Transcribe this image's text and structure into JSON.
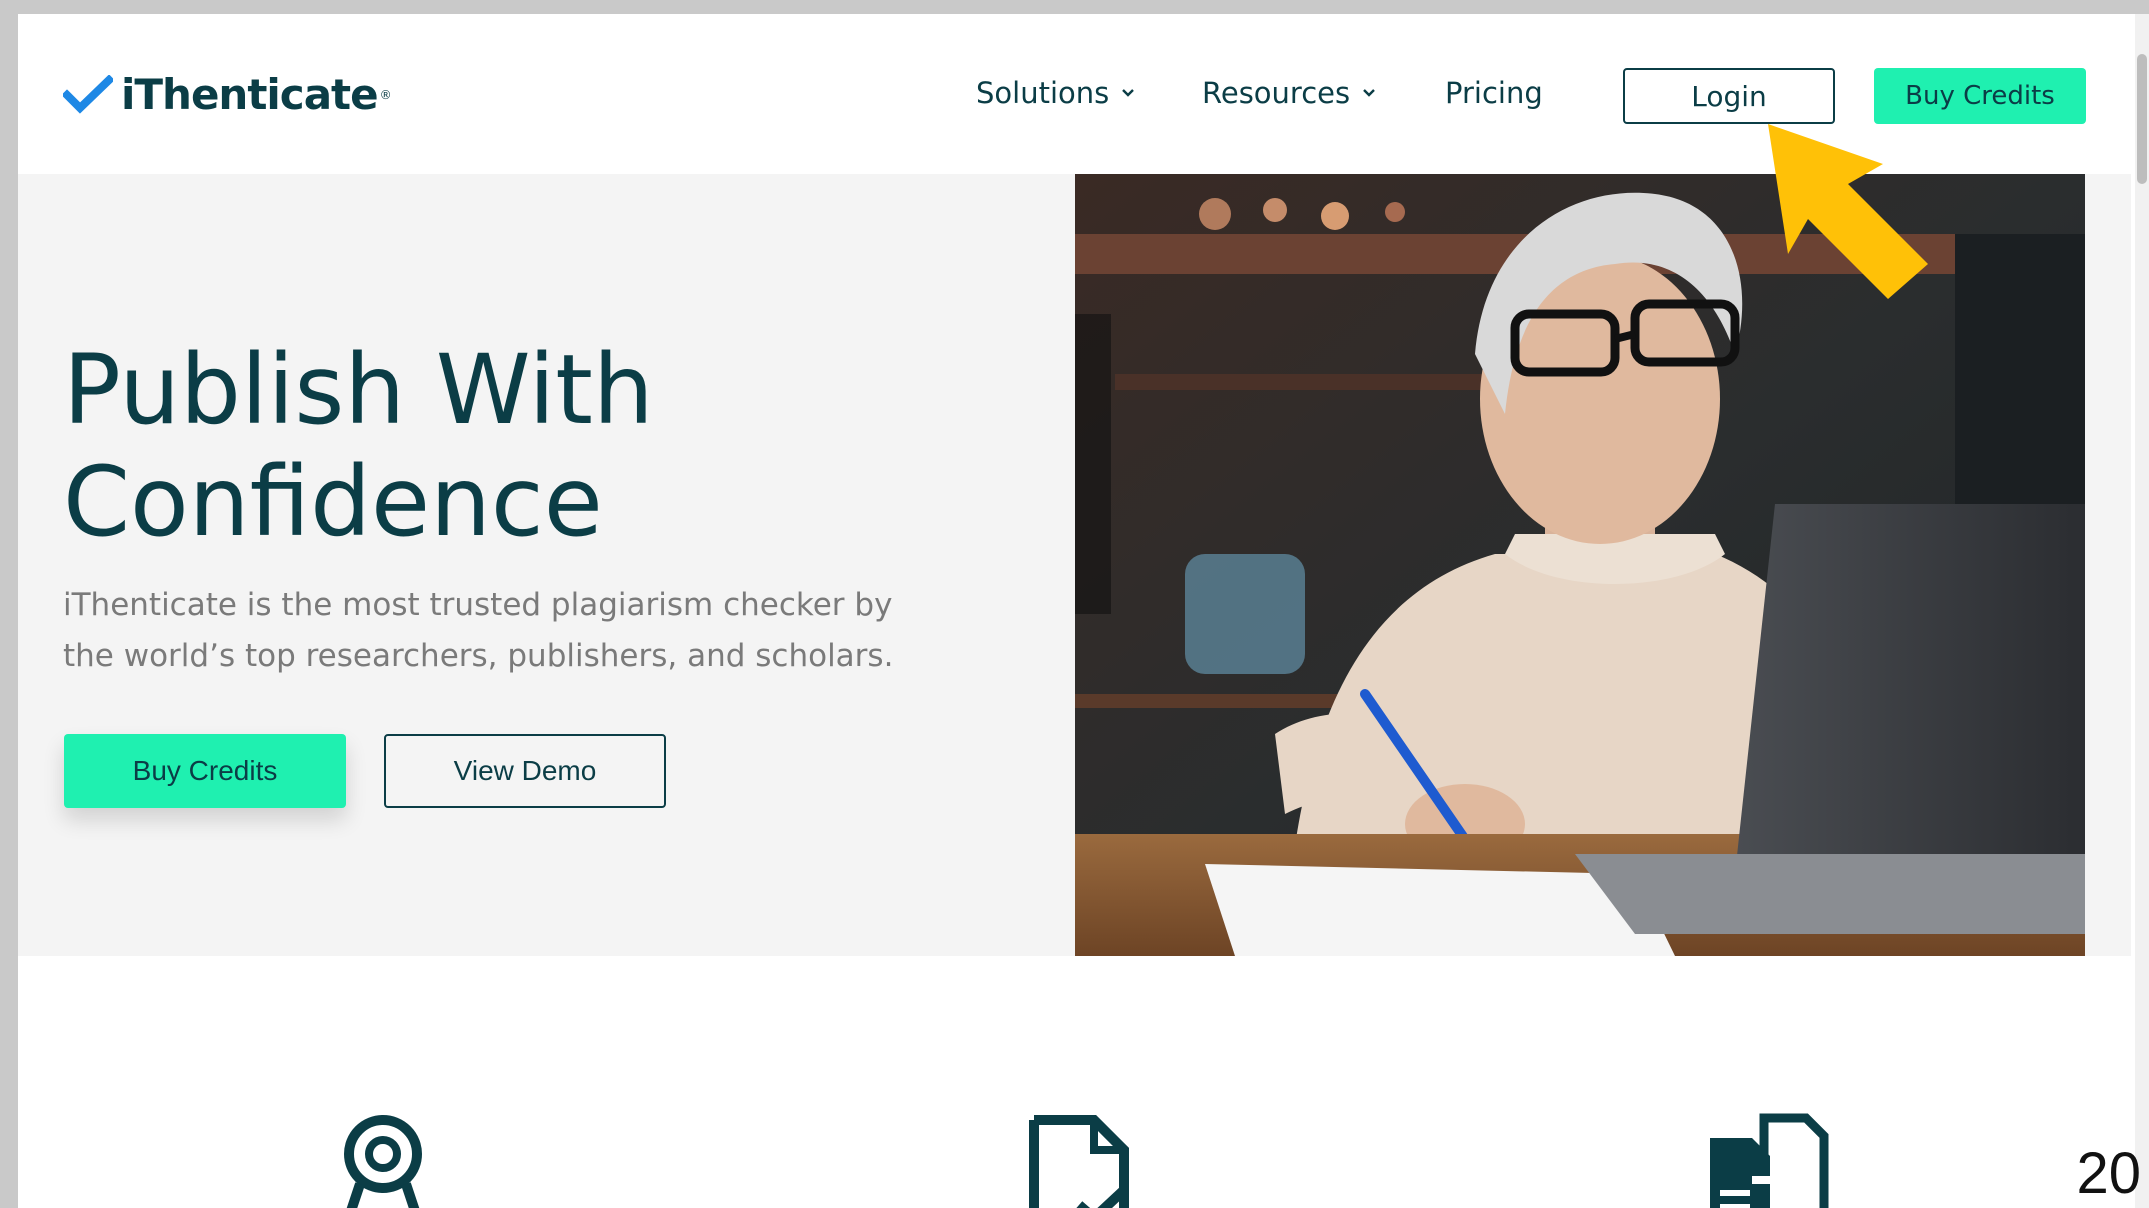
{
  "brand": {
    "name": "iThenticate",
    "reg_mark": "®",
    "primary_color": "#0b3d46",
    "accent_color": "#1ff0b0",
    "check_color": "#1e88e5"
  },
  "nav": {
    "solutions_label": "Solutions",
    "resources_label": "Resources",
    "pricing_label": "Pricing",
    "login_label": "Login",
    "buy_credits_label": "Buy Credits"
  },
  "hero": {
    "title_line1": "Publish With",
    "title_line2": "Confidence",
    "subtitle_line1": "iThenticate is the most trusted plagiarism checker by",
    "subtitle_line2": "the world’s top researchers, publishers, and scholars.",
    "buy_credits_label": "Buy Credits",
    "view_demo_label": "View Demo",
    "image_subject": "woman with glasses writing notes at a laptop"
  },
  "annotation": {
    "arrow_color": "#ffc107",
    "arrow_target": "login-button"
  },
  "features": {
    "icons": [
      "award-ribbon-icon",
      "document-check-icon",
      "document-compare-icon"
    ]
  },
  "slide": {
    "number": "20"
  }
}
